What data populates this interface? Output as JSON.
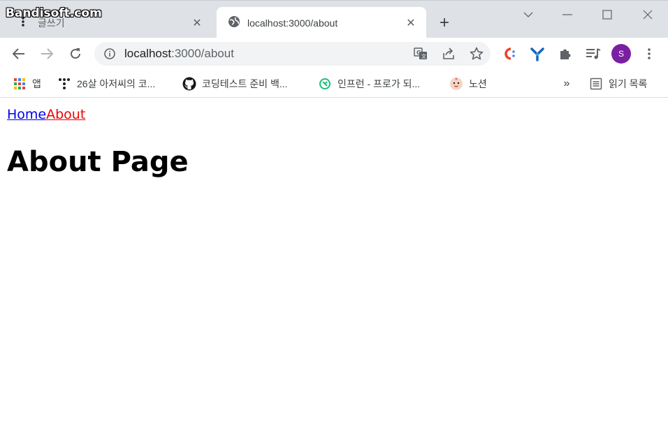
{
  "watermark": "Bandisoft.com",
  "tabs": [
    {
      "title": "글쓰기",
      "active": false
    },
    {
      "title": "localhost:3000/about",
      "active": true
    }
  ],
  "omnibox": {
    "host": "localhost",
    "path": ":3000/about"
  },
  "profile": {
    "initial": "S",
    "color": "#7b1fa2"
  },
  "bookmarks": [
    {
      "label": "앱",
      "icon": "apps-grid-icon"
    },
    {
      "label": "26살 아저씨의 코...",
      "icon": "dots-logo-icon"
    },
    {
      "label": "코딩테스트 준비 백...",
      "icon": "github-icon"
    },
    {
      "label": "인프런 - 프로가 되...",
      "icon": "inflearn-icon"
    },
    {
      "label": "노션",
      "icon": "notion-face-icon"
    }
  ],
  "bookmarks_more": "»",
  "reading_list": {
    "label": "읽기 목록"
  },
  "page": {
    "nav": {
      "home": "Home",
      "about": "About"
    },
    "heading": "About Page"
  },
  "colors": {
    "tabstrip": "#dee1e6",
    "link_home": "#0000ee",
    "link_about": "#ee0000"
  }
}
